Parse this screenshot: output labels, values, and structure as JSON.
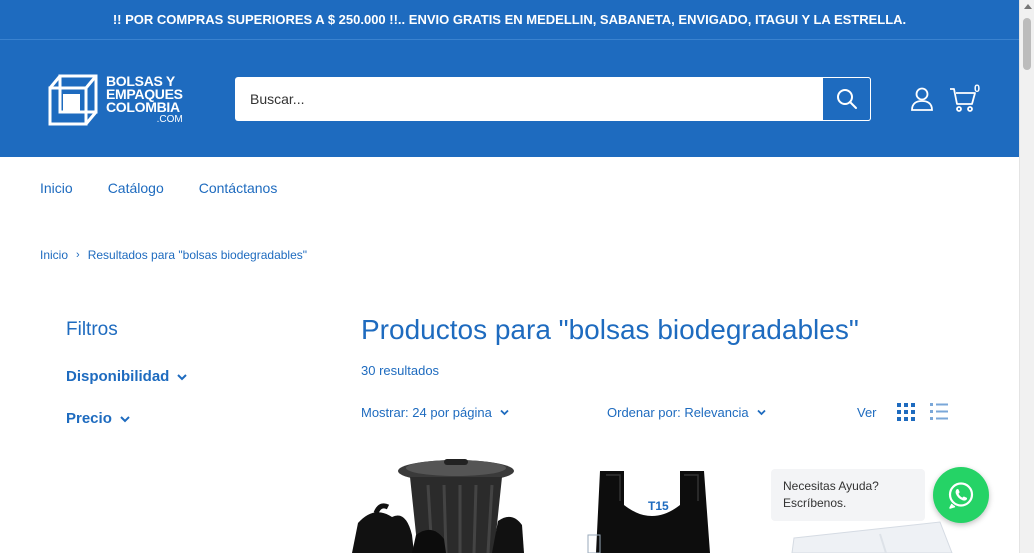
{
  "announcement": "!! POR COMPRAS SUPERIORES A $ 250.000 !!.. ENVIO GRATIS EN MEDELLIN, SABANETA, ENVIGADO, ITAGUI Y LA ESTRELLA.",
  "logo": {
    "line1": "BOLSAS Y",
    "line2": "EMPAQUES",
    "line3": "COLOMBIA",
    "line4": ".COM"
  },
  "search": {
    "placeholder": "Buscar..."
  },
  "cart": {
    "count": "0"
  },
  "nav": {
    "items": [
      "Inicio",
      "Catálogo",
      "Contáctanos"
    ]
  },
  "breadcrumb": {
    "home": "Inicio",
    "separator": "›",
    "current": "Resultados para \"bolsas biodegradables\""
  },
  "filters": {
    "title": "Filtros",
    "items": [
      "Disponibilidad",
      "Precio"
    ]
  },
  "results": {
    "title": "Productos para \"bolsas biodegradables\"",
    "count": "30 resultados"
  },
  "toolbar": {
    "show": "Mostrar: 24 por página",
    "sort": "Ordenar por: Relevancia",
    "view": "Ver"
  },
  "products": [
    {
      "image_label": ""
    },
    {
      "image_label": "T15"
    },
    {
      "image_label": ""
    }
  ],
  "chat": {
    "line1": "Necesitas Ayuda?",
    "line2": "Escríbenos."
  },
  "colors": {
    "brand": "#1e6bbf",
    "whatsapp": "#25d366"
  }
}
